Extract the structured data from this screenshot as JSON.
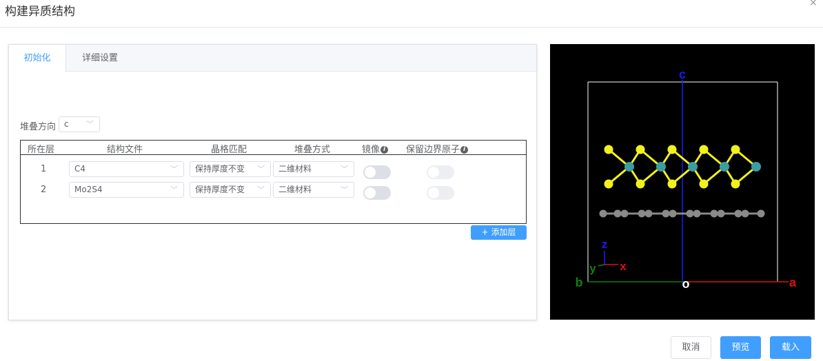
{
  "dialog": {
    "title": "构建异质结构",
    "close_glyph": "×"
  },
  "tabs": [
    {
      "label": "初始化",
      "active": true
    },
    {
      "label": "详细设置",
      "active": false
    }
  ],
  "stacking_direction": {
    "label": "堆叠方向",
    "value": "c"
  },
  "layer_table": {
    "headers": {
      "layer": "所在层",
      "structure_file": "结构文件",
      "lattice_match": "晶格匹配",
      "stack_mode": "堆叠方式",
      "mirror": "镜像",
      "keep_boundary": "保留边界原子"
    },
    "rows": [
      {
        "index": "1",
        "structure_file": "C4",
        "lattice_match": "保持厚度不变",
        "stack_mode": "二维材料",
        "mirror": false,
        "keep_boundary": false
      },
      {
        "index": "2",
        "structure_file": "Mo2S4",
        "lattice_match": "保持厚度不变",
        "stack_mode": "二维材料",
        "mirror": false,
        "keep_boundary": false
      }
    ]
  },
  "add_layer_button": {
    "icon": "+",
    "label": "添加层"
  },
  "viewer": {
    "axis_labels": {
      "c": "c",
      "a": "a",
      "b": "b",
      "o": "o",
      "x": "x",
      "y": "y",
      "z": "z"
    },
    "colors": {
      "background": "#000000",
      "cell_edge": "#ffffff",
      "axis_c": "#1a1aff",
      "axis_a": "#e01010",
      "axis_b": "#108010",
      "sulfur": "#f2f21a",
      "molybdenum": "#3a9da5",
      "carbon": "#8a8a8a"
    }
  },
  "footer": {
    "cancel_label": "取消",
    "preview_label": "预览",
    "load_label": "载入"
  }
}
